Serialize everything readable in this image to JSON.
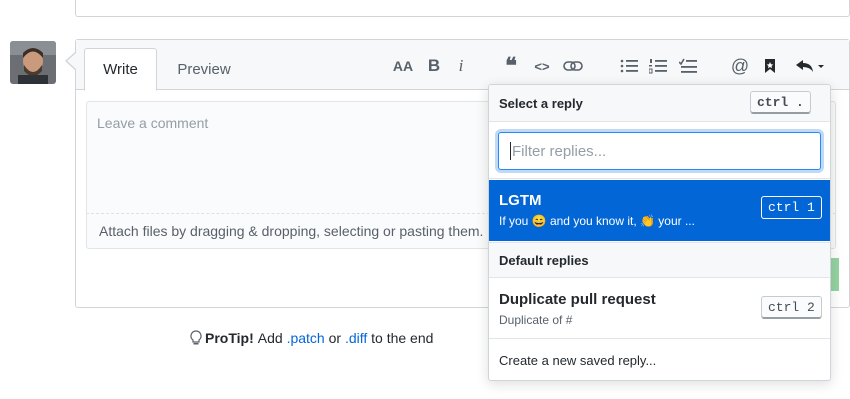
{
  "tabs": {
    "write": "Write",
    "preview": "Preview"
  },
  "toolbar": {
    "text_size": "AA",
    "bold": "B",
    "italic": "i",
    "quote": "❝",
    "code": "<>"
  },
  "editor": {
    "placeholder": "Leave a comment",
    "attach_text": "Attach files by dragging & dropping, selecting or pasting them."
  },
  "protip": {
    "label": "ProTip!",
    "text1": "Add",
    "link1": ".patch",
    "text2": "or",
    "link2": ".diff",
    "text3": "to the end"
  },
  "dropdown": {
    "header": "Select a reply",
    "header_shortcut": "ctrl .",
    "filter_placeholder": "Filter replies...",
    "selected": {
      "title": "LGTM",
      "subtitle": "If you 😄 and you know it, 👏 your ...",
      "shortcut": "ctrl 1"
    },
    "section_label": "Default replies",
    "items": [
      {
        "title": "Duplicate pull request",
        "subtitle": "Duplicate of #",
        "shortcut": "ctrl 2"
      }
    ],
    "create_label": "Create a new saved reply..."
  },
  "colors": {
    "accent": "#0366d6",
    "border": "#d1d5da",
    "success": "#94d3a2"
  }
}
